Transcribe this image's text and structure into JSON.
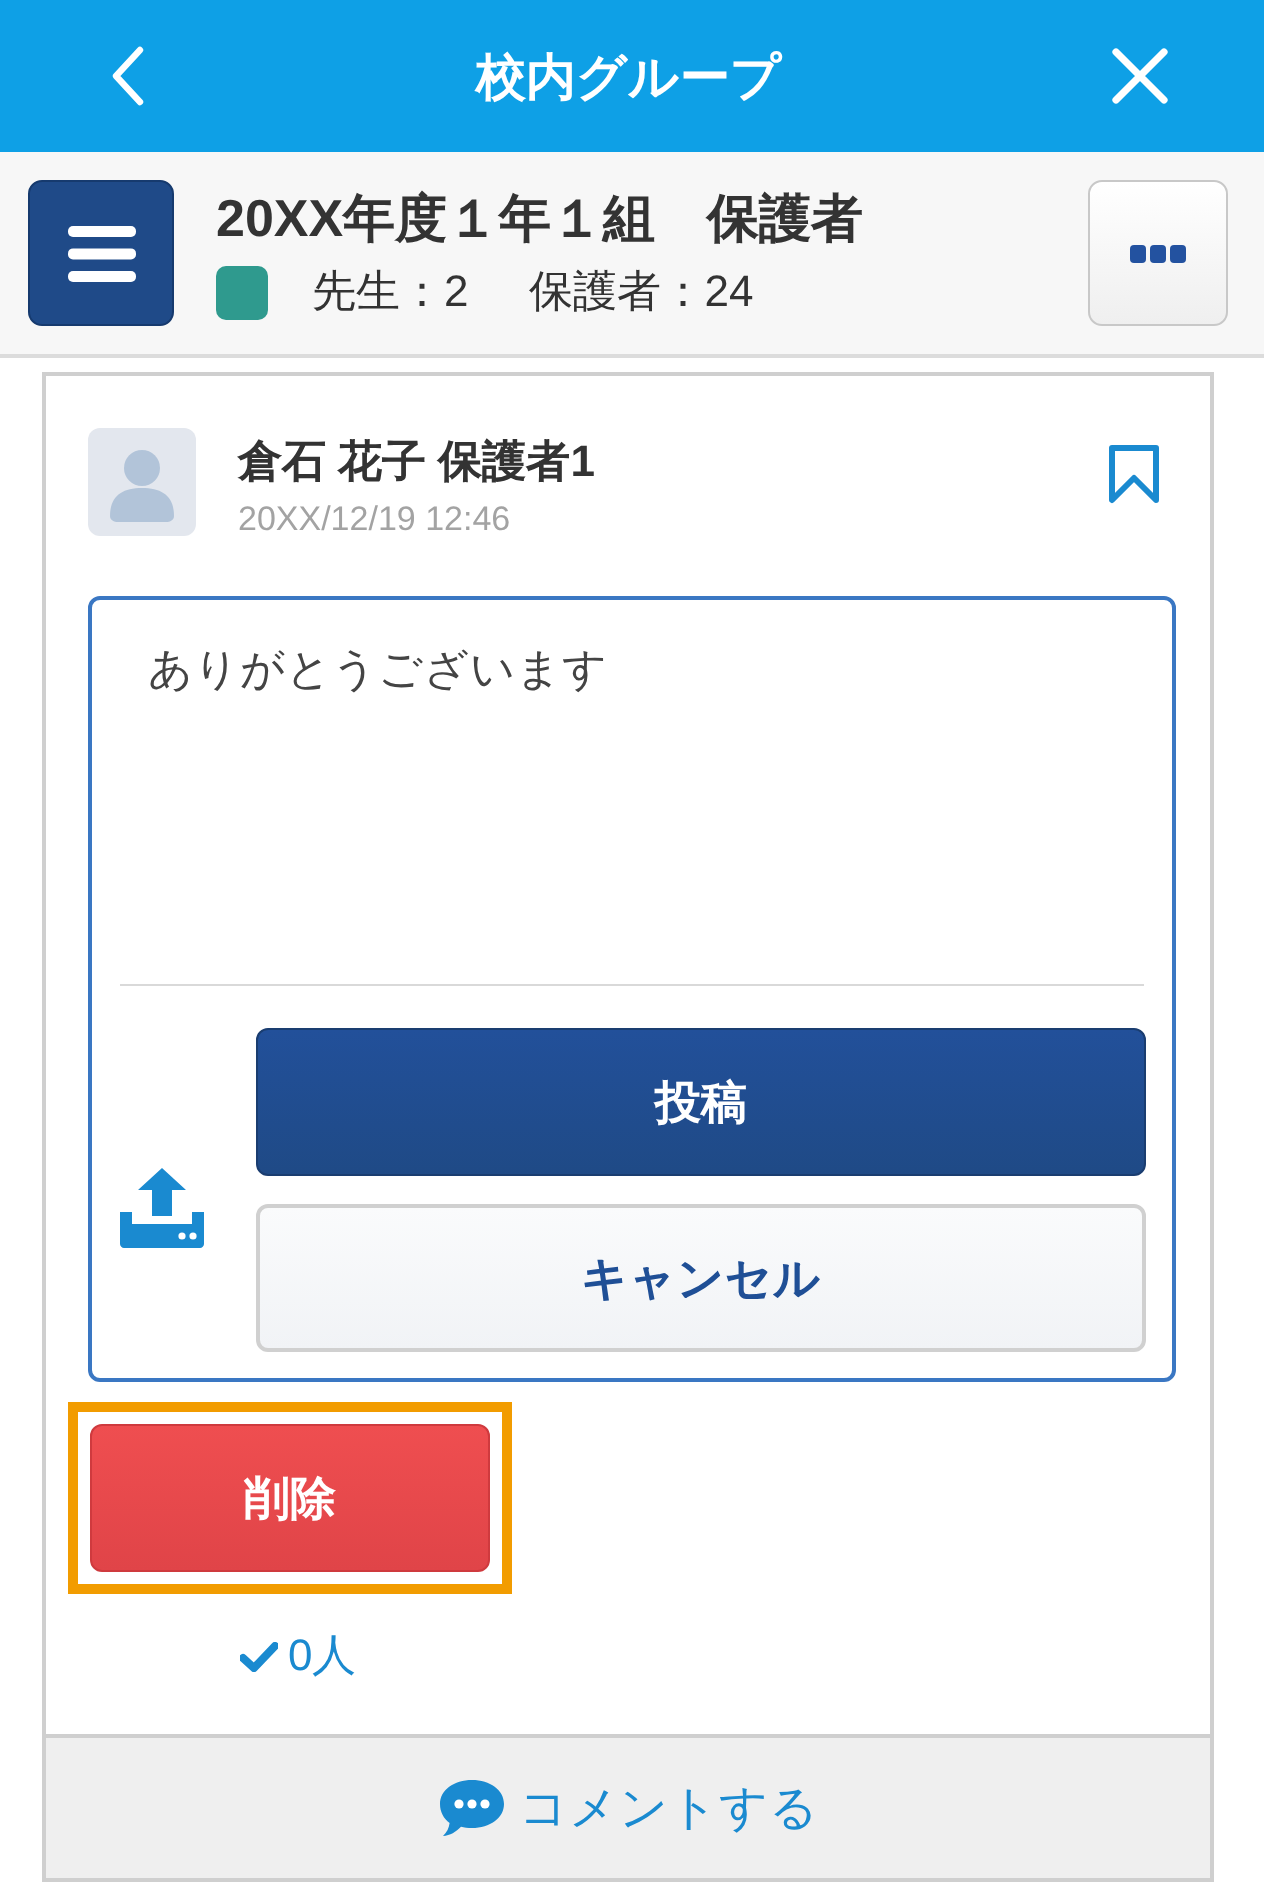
{
  "header": {
    "title": "校内グループ"
  },
  "group": {
    "name": "20XX年度１年１組　保護者",
    "teachers": "先生：2",
    "guardians": "保護者：24"
  },
  "post": {
    "author": "倉石 花子 保護者1",
    "timestamp": "20XX/12/19 12:46",
    "bookmarked": false,
    "editor": {
      "value": "ありがとうございます"
    },
    "buttons": [
      {
        "label": "投稿",
        "kind": "primary"
      },
      {
        "label": "キャンセル",
        "kind": "secondary"
      }
    ],
    "delete_button": {
      "label": "削除",
      "highlighted": true
    },
    "read_count": "0人"
  },
  "footer": {
    "comment_label": "コメントする"
  }
}
